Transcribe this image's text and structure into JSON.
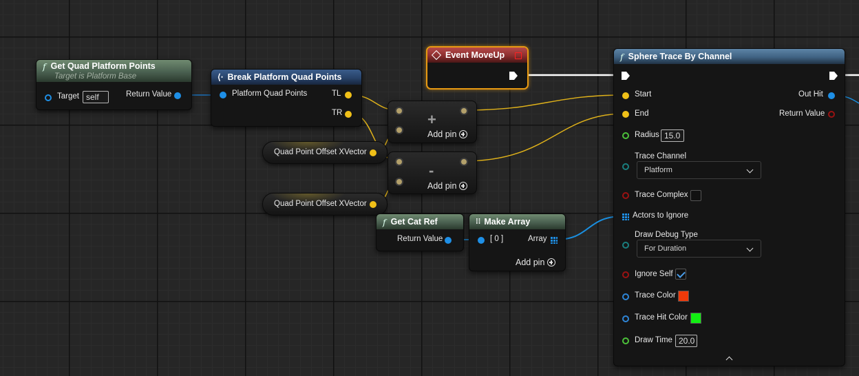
{
  "nodes": {
    "get_quad": {
      "title": "Get Quad Platform Points",
      "subtitle": "Target is Platform Base",
      "target_label": "Target",
      "target_value": "self",
      "return_label": "Return Value"
    },
    "break_points": {
      "title": "Break Platform Quad Points",
      "input_label": "Platform Quad Points",
      "tl_label": "TL",
      "tr_label": "TR"
    },
    "add_op": {
      "symbol": "+",
      "add_pin_label": "Add pin"
    },
    "sub_op": {
      "symbol": "-",
      "add_pin_label": "Add pin"
    },
    "offset_var_1": {
      "label": "Quad Point Offset XVector"
    },
    "offset_var_2": {
      "label": "Quad Point Offset XVector"
    },
    "event": {
      "title": "Event MoveUp"
    },
    "get_cat_ref": {
      "title": "Get Cat Ref",
      "return_label": "Return Value"
    },
    "make_array": {
      "title": "Make Array",
      "index_label": "[ 0 ]",
      "array_label": "Array",
      "add_pin_label": "Add pin"
    },
    "sphere_trace": {
      "title": "Sphere Trace By Channel",
      "start_label": "Start",
      "end_label": "End",
      "radius_label": "Radius",
      "radius_value": "15.0",
      "trace_channel_label": "Trace Channel",
      "trace_channel_value": "Platform",
      "trace_complex_label": "Trace Complex",
      "actors_label": "Actors to Ignore",
      "draw_debug_label": "Draw Debug Type",
      "draw_debug_value": "For Duration",
      "ignore_self_label": "Ignore Self",
      "trace_color_label": "Trace Color",
      "trace_hit_color_label": "Trace Hit Color",
      "draw_time_label": "Draw Time",
      "draw_time_value": "20.0",
      "out_hit_label": "Out Hit",
      "return_label": "Return Value"
    }
  },
  "colors": {
    "trace_color": "#f03a0a",
    "trace_hit_color": "#12ee12",
    "vector_wire": "#e0b21a",
    "object_wire": "#1a8fe0",
    "exec_wire": "#ffffff"
  }
}
